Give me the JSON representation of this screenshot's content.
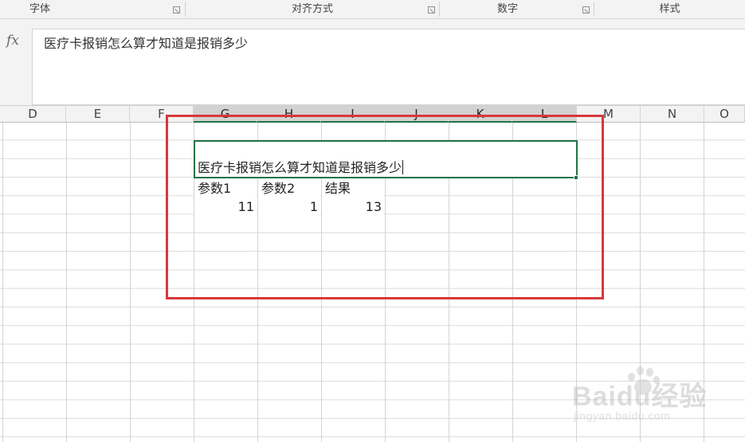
{
  "ribbon": {
    "groups": [
      {
        "label": "字体"
      },
      {
        "label": "对齐方式"
      },
      {
        "label": "数字"
      },
      {
        "label": "样式"
      }
    ]
  },
  "formula_bar": {
    "fx_label": "fx",
    "value": "医疗卡报销怎么算才知道是报销多少"
  },
  "columns": [
    "D",
    "E",
    "F",
    "G",
    "H",
    "I",
    "J",
    "K",
    "L",
    "M",
    "N",
    "O"
  ],
  "sheet": {
    "merged_text": "医疗卡报销怎么算才知道是报销多少",
    "headers": {
      "param1": "参数1",
      "param2": "参数2",
      "result": "结果"
    },
    "values": {
      "param1": "11",
      "param2": "1",
      "result": "13"
    }
  },
  "watermark": {
    "logo": "Baidu经验",
    "url": "jingyan.baidu.com"
  },
  "colors": {
    "selection": "#217346",
    "highlight_box": "#d9383a"
  }
}
